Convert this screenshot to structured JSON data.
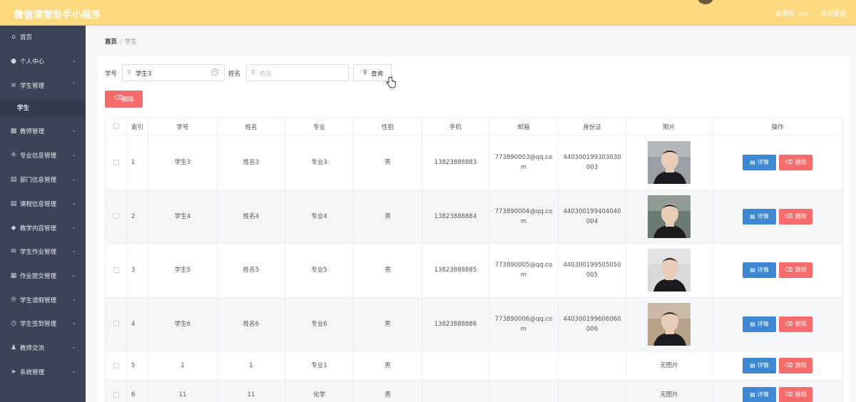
{
  "header": {
    "app_title": "微信课堂助手小程序",
    "admin_label": "管理员 abo",
    "logout_label": "退出登录"
  },
  "sidebar": {
    "items": [
      {
        "label": "首页",
        "icon": "home-icon",
        "has_arrow": false
      },
      {
        "label": "个人中心",
        "icon": "user-icon",
        "has_arrow": true
      },
      {
        "label": "学生管理",
        "icon": "list-icon",
        "has_arrow": true,
        "expanded": true
      },
      {
        "label": "学生",
        "icon": "",
        "has_arrow": false,
        "sub": true
      },
      {
        "label": "教师管理",
        "icon": "briefcase-icon",
        "has_arrow": true
      },
      {
        "label": "专业信息管理",
        "icon": "sliders-icon",
        "has_arrow": true
      },
      {
        "label": "部门信息管理",
        "icon": "bar-chart-icon",
        "has_arrow": true
      },
      {
        "label": "课程信息管理",
        "icon": "document-icon",
        "has_arrow": true
      },
      {
        "label": "教学内容管理",
        "icon": "shield-icon",
        "has_arrow": true
      },
      {
        "label": "学生作业管理",
        "icon": "mail-icon",
        "has_arrow": true
      },
      {
        "label": "作业提交管理",
        "icon": "grid-icon",
        "has_arrow": true
      },
      {
        "label": "学生请假管理",
        "icon": "compass-icon",
        "has_arrow": true
      },
      {
        "label": "学生签到管理",
        "icon": "clock-icon",
        "has_arrow": true
      },
      {
        "label": "教师交流",
        "icon": "person-icon",
        "has_arrow": true
      },
      {
        "label": "系统管理",
        "icon": "send-icon",
        "has_arrow": true
      }
    ]
  },
  "breadcrumb": {
    "home": "首页",
    "separator": "/",
    "current": "学生"
  },
  "search": {
    "student_no_label": "学号",
    "student_no_value": "学生3",
    "name_label": "姓名",
    "name_placeholder": "姓名",
    "query_label": "查询"
  },
  "toolbar": {
    "delete_label": "删除"
  },
  "table": {
    "headers": [
      "索引",
      "学号",
      "姓名",
      "专业",
      "性别",
      "手机",
      "邮箱",
      "身份证",
      "照片",
      "操作"
    ],
    "detail_label": "详情",
    "delete_label": "删除",
    "no_photo_label": "无图片",
    "rows": [
      {
        "index": "1",
        "student_no": "学生3",
        "name": "姓名3",
        "major": "专业3",
        "gender": "男",
        "phone": "13823888883",
        "email": "773890003@qq.com",
        "id_card": "440300199303030003",
        "photo": "photo-3"
      },
      {
        "index": "2",
        "student_no": "学生4",
        "name": "姓名4",
        "major": "专业4",
        "gender": "男",
        "phone": "13823888884",
        "email": "773890004@qq.com",
        "id_card": "440300199404040004",
        "photo": "photo-4"
      },
      {
        "index": "3",
        "student_no": "学生5",
        "name": "姓名5",
        "major": "专业5",
        "gender": "男",
        "phone": "13823888885",
        "email": "773890005@qq.com",
        "id_card": "440300199505050005",
        "photo": "photo-5"
      },
      {
        "index": "4",
        "student_no": "学生6",
        "name": "姓名6",
        "major": "专业6",
        "gender": "男",
        "phone": "13823888886",
        "email": "773890006@qq.com",
        "id_card": "440300199606060006",
        "photo": "photo-6"
      },
      {
        "index": "5",
        "student_no": "1",
        "name": "1",
        "major": "专业1",
        "gender": "男",
        "phone": "",
        "email": "",
        "id_card": "",
        "photo": ""
      },
      {
        "index": "6",
        "student_no": "11",
        "name": "11",
        "major": "化学",
        "gender": "男",
        "phone": "",
        "email": "",
        "id_card": "",
        "photo": ""
      }
    ]
  },
  "colors": {
    "header_bg": "#fdd980",
    "sidebar_bg": "#3c4356",
    "danger": "#f56c6c",
    "primary": "#3d88d0"
  }
}
